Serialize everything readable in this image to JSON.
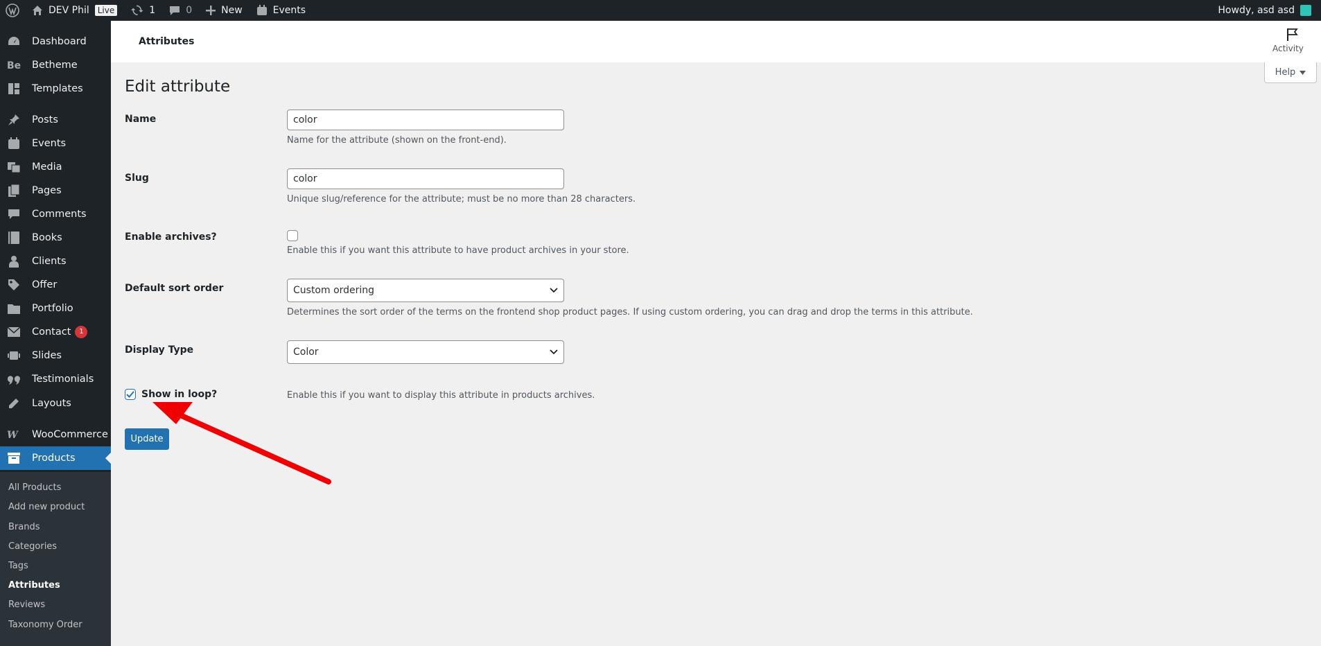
{
  "adminbar": {
    "site_name": "DEV Phil",
    "live_label": "Live",
    "updates_count": "1",
    "comments_count": "0",
    "new_label": "New",
    "events_label": "Events",
    "greeting": "Howdy, asd asd"
  },
  "sidebar": {
    "items": [
      {
        "label": "Dashboard",
        "icon": "dashboard-icon"
      },
      {
        "label": "Betheme",
        "icon": "betheme-icon"
      },
      {
        "label": "Templates",
        "icon": "templates-icon"
      },
      {
        "label": "Posts",
        "icon": "pin-icon"
      },
      {
        "label": "Events",
        "icon": "calendar-icon"
      },
      {
        "label": "Media",
        "icon": "media-icon"
      },
      {
        "label": "Pages",
        "icon": "pages-icon"
      },
      {
        "label": "Comments",
        "icon": "comment-icon"
      },
      {
        "label": "Books",
        "icon": "book-icon"
      },
      {
        "label": "Clients",
        "icon": "person-icon"
      },
      {
        "label": "Offer",
        "icon": "tag-icon"
      },
      {
        "label": "Portfolio",
        "icon": "folder-icon"
      },
      {
        "label": "Contact",
        "icon": "mail-icon",
        "badge": "1"
      },
      {
        "label": "Slides",
        "icon": "slides-icon"
      },
      {
        "label": "Testimonials",
        "icon": "quote-icon"
      },
      {
        "label": "Layouts",
        "icon": "pencil-icon"
      },
      {
        "label": "WooCommerce",
        "icon": "woocommerce-icon"
      },
      {
        "label": "Products",
        "icon": "archive-icon"
      }
    ],
    "submenu": [
      "All Products",
      "Add new product",
      "Brands",
      "Categories",
      "Tags",
      "Attributes",
      "Reviews",
      "Taxonomy Order"
    ]
  },
  "header": {
    "title": "Attributes",
    "activity_label": "Activity",
    "help_label": "Help"
  },
  "form": {
    "page_title": "Edit attribute",
    "name_label": "Name",
    "name_value": "color",
    "name_desc": "Name for the attribute (shown on the front-end).",
    "slug_label": "Slug",
    "slug_value": "color",
    "slug_desc": "Unique slug/reference for the attribute; must be no more than 28 characters.",
    "archives_label": "Enable archives?",
    "archives_desc": "Enable this if you want this attribute to have product archives in your store.",
    "sort_label": "Default sort order",
    "sort_value": "Custom ordering",
    "sort_desc": "Determines the sort order of the terms on the frontend shop product pages. If using custom ordering, you can drag and drop the terms in this attribute.",
    "display_label": "Display Type",
    "display_value": "Color",
    "loop_label": "Show in loop?",
    "loop_desc": "Enable this if you want to display this attribute in products archives.",
    "update_label": "Update"
  },
  "colors": {
    "admin_dark": "#1d2327",
    "accent": "#2271b1",
    "annotation_arrow": "#f00000"
  }
}
